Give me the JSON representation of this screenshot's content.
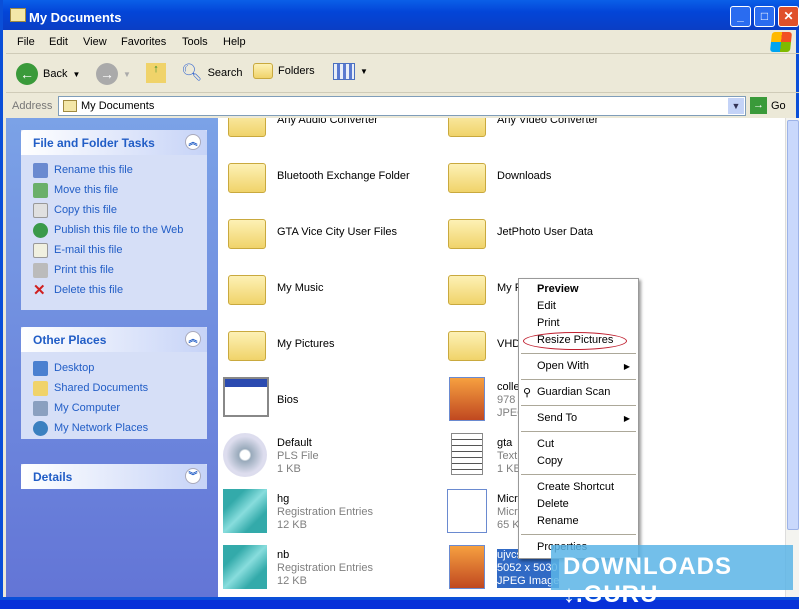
{
  "window": {
    "title": "My Documents"
  },
  "menu": [
    "File",
    "Edit",
    "View",
    "Favorites",
    "Tools",
    "Help"
  ],
  "toolbar": {
    "back": "Back",
    "search": "Search",
    "folders": "Folders"
  },
  "address": {
    "label": "Address",
    "value": "My Documents",
    "go": "Go"
  },
  "tasks": {
    "title": "File and Folder Tasks",
    "items": [
      "Rename this file",
      "Move this file",
      "Copy this file",
      "Publish this file to the Web",
      "E-mail this file",
      "Print this file",
      "Delete this file"
    ]
  },
  "places": {
    "title": "Other Places",
    "items": [
      "Desktop",
      "Shared Documents",
      "My Computer",
      "My Network Places"
    ]
  },
  "details": {
    "title": "Details"
  },
  "files": [
    {
      "name": "Any Audio Converter",
      "type": "folder"
    },
    {
      "name": "Any Video Converter",
      "type": "folder"
    },
    {
      "name": "Bluetooth Exchange Folder",
      "type": "folder"
    },
    {
      "name": "Downloads",
      "type": "folder"
    },
    {
      "name": "GTA Vice City User Files",
      "type": "folder"
    },
    {
      "name": "JetPhoto User Data",
      "type": "folder"
    },
    {
      "name": "My Music",
      "type": "folder"
    },
    {
      "name": "My Pl",
      "type": "folder"
    },
    {
      "name": "My Pictures",
      "type": "folder"
    },
    {
      "name": "VHD",
      "type": "folder"
    },
    {
      "name": "Bios",
      "type": "app"
    },
    {
      "name": "collet",
      "l2": "978 x",
      "l3": "JPEG",
      "type": "image"
    },
    {
      "name": "Default",
      "l2": "PLS File",
      "l3": "1 KB",
      "type": "media"
    },
    {
      "name": "gta",
      "l2": "Text",
      "l3": "1 KB",
      "type": "text"
    },
    {
      "name": "hg",
      "l2": "Registration Entries",
      "l3": "12 KB",
      "type": "reg"
    },
    {
      "name": "Micro",
      "l2": "Micro",
      "l3": "65 KB",
      "type": "word"
    },
    {
      "name": "nb",
      "l2": "Registration Entries",
      "l3": "12 KB",
      "type": "reg"
    },
    {
      "name": "ujvcs",
      "l2": "5052 x 5030",
      "l3": "JPEG Image",
      "type": "image",
      "selected": true
    }
  ],
  "context_menu": {
    "items": [
      "Preview",
      "Edit",
      "Print",
      "Resize Pictures",
      "Open With",
      "Guardian Scan",
      "Send To",
      "Cut",
      "Copy",
      "Create Shortcut",
      "Delete",
      "Rename",
      "Properties"
    ]
  },
  "watermark": "DOWNLOADS ↓.GURU"
}
